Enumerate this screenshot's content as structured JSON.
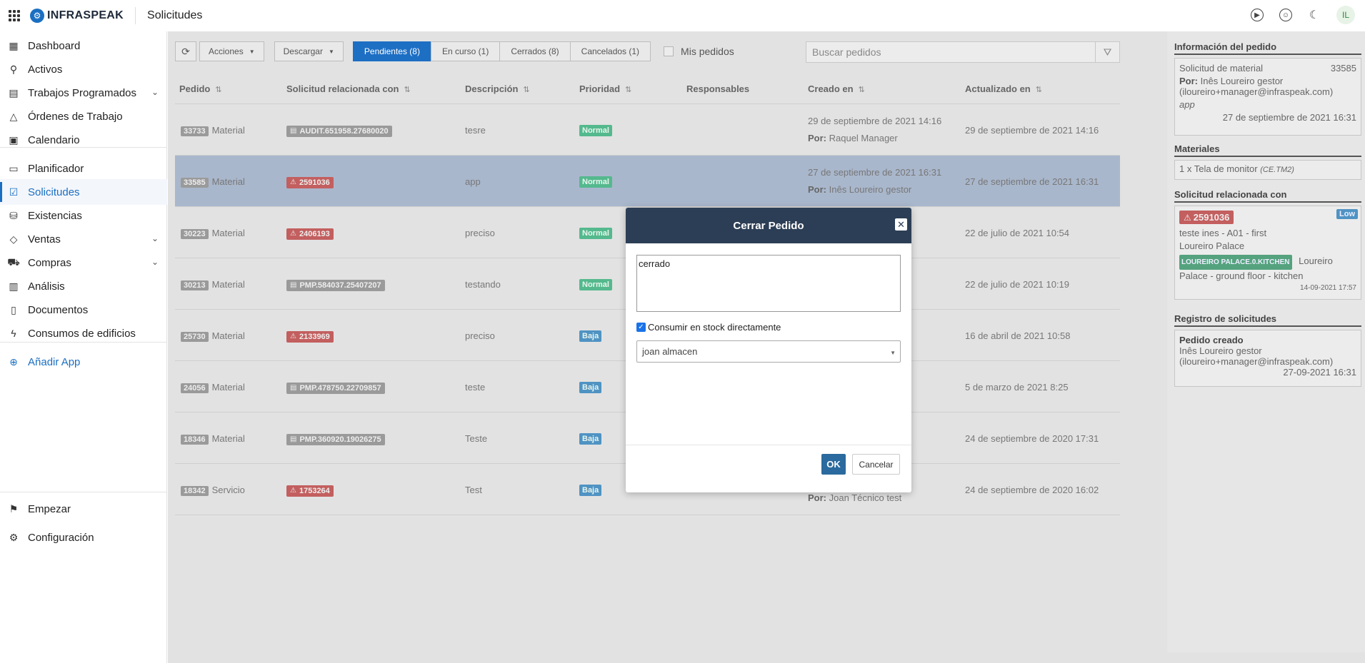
{
  "header": {
    "brand": "INFRASPEAK",
    "brand_mark": "⚙",
    "title": "Solicitudes",
    "avatar_initials": "IL"
  },
  "sidebar": {
    "items": [
      {
        "label": "Dashboard",
        "icon": "dashboard-icon",
        "glyph": "▦"
      },
      {
        "label": "Activos",
        "icon": "pin-icon",
        "glyph": "⚲"
      },
      {
        "label": "Trabajos Programados",
        "icon": "calendar-gear-icon",
        "glyph": "▤",
        "has_chevron": true
      },
      {
        "label": "Órdenes de Trabajo",
        "icon": "warning-icon",
        "glyph": "△"
      },
      {
        "label": "Calendario",
        "icon": "calendar-icon",
        "glyph": "▣"
      },
      {
        "label": "Planificador",
        "icon": "planner-icon",
        "glyph": "▭"
      },
      {
        "label": "Solicitudes",
        "icon": "requests-icon",
        "glyph": "☑",
        "active": true
      },
      {
        "label": "Existencias",
        "icon": "stock-icon",
        "glyph": "⛁"
      },
      {
        "label": "Ventas",
        "icon": "tag-icon",
        "glyph": "◇",
        "has_chevron": true
      },
      {
        "label": "Compras",
        "icon": "cart-icon",
        "glyph": "⛟",
        "has_chevron": true
      },
      {
        "label": "Análisis",
        "icon": "bar-chart-icon",
        "glyph": "▥"
      },
      {
        "label": "Documentos",
        "icon": "document-icon",
        "glyph": "▯"
      },
      {
        "label": "Consumos de edificios",
        "icon": "lightning-icon",
        "glyph": "ϟ"
      },
      {
        "label": "Añadir App",
        "icon": "plus-circle-icon",
        "glyph": "⊕"
      }
    ],
    "footer": [
      {
        "label": "Empezar",
        "icon": "flag-icon",
        "glyph": "⚑"
      },
      {
        "label": "Configuración",
        "icon": "gear-icon",
        "glyph": "⚙"
      }
    ]
  },
  "toolbar": {
    "acciones": "Acciones",
    "descargar": "Descargar",
    "tabs": [
      "Pendientes (8)",
      "En curso (1)",
      "Cerrados (8)",
      "Cancelados (1)"
    ],
    "mis_pedidos": "Mis pedidos",
    "search_placeholder": "Buscar pedidos"
  },
  "table": {
    "headers": [
      "Pedido",
      "Solicitud relacionada con",
      "Descripción",
      "Prioridad",
      "Responsables",
      "Creado en",
      "Actualizado en"
    ],
    "rows": [
      {
        "id": "33733",
        "type": "Material",
        "ref": "AUDIT.651958.27680020",
        "ref_color": "grey",
        "ref_icon": "clipboard-icon",
        "desc": "tesre",
        "priority": "Normal",
        "created": "29 de septiembre de 2021 14:16",
        "by_label": "Por:",
        "by": "Raquel Manager",
        "updated": "29 de septiembre de 2021 14:16"
      },
      {
        "id": "33585",
        "type": "Material",
        "ref": "2591036",
        "ref_color": "red",
        "ref_icon": "warning-icon",
        "desc": "app",
        "priority": "Normal",
        "created": "27 de septiembre de 2021 16:31",
        "by_label": "Por:",
        "by": "Inês Loureiro gestor",
        "updated": "27 de septiembre de 2021 16:31",
        "selected": true
      },
      {
        "id": "30223",
        "type": "Material",
        "ref": "2406193",
        "ref_color": "red",
        "ref_icon": "warning-icon",
        "desc": "preciso",
        "priority": "Normal",
        "created": "",
        "by_label": "",
        "by": "",
        "updated": "22 de julio de 2021 10:54"
      },
      {
        "id": "30213",
        "type": "Material",
        "ref": "PMP.584037.25407207",
        "ref_color": "grey",
        "ref_icon": "calendar-icon",
        "desc": "testando",
        "priority": "Normal",
        "created": "",
        "by_label": "",
        "by": "",
        "updated": "22 de julio de 2021 10:19"
      },
      {
        "id": "25730",
        "type": "Material",
        "ref": "2133969",
        "ref_color": "red",
        "ref_icon": "warning-icon",
        "desc": "preciso",
        "priority": "Baja",
        "created": "",
        "by_label": "",
        "by": "",
        "updated": "16 de abril de 2021 10:58"
      },
      {
        "id": "24056",
        "type": "Material",
        "ref": "PMP.478750.22709857",
        "ref_color": "grey",
        "ref_icon": "calendar-icon",
        "desc": "teste",
        "priority": "Baja",
        "created": "",
        "by_label": "",
        "by": "",
        "updated": "5 de marzo de 2021 8:25"
      },
      {
        "id": "18346",
        "type": "Material",
        "ref": "PMP.360920.19026275",
        "ref_color": "grey",
        "ref_icon": "calendar-icon",
        "desc": "Teste",
        "priority": "Baja",
        "created": "",
        "by_label": "",
        "by": "",
        "updated": "24 de septiembre de 2020 17:31"
      },
      {
        "id": "18342",
        "type": "Servicio",
        "ref": "1753264",
        "ref_color": "red",
        "ref_icon": "warning-icon",
        "desc": "Test",
        "priority": "Baja",
        "created": "",
        "by_label": "Por:",
        "by": "Joan Técnico test",
        "updated": "24 de septiembre de 2020 16:02"
      }
    ]
  },
  "right_panel": {
    "info_title": "Información del pedido",
    "info_type": "Solicitud de material",
    "info_id": "33585",
    "info_by_label": "Por:",
    "info_by": "Inês Loureiro gestor",
    "info_email": "(iloureiro+manager@infraspeak.com)",
    "info_desc": "app",
    "info_date": "27 de septiembre de 2021 16:31",
    "materials_title": "Materiales",
    "material": "1 x Tela de monitor",
    "material_code": "(CE.TM2)",
    "related_title": "Solicitud relacionada con",
    "related_ref": "2591036",
    "related_priority": "Low",
    "related_desc": "teste ines - A01 - first",
    "related_place": "Loureiro Palace",
    "related_loc_badge": "LOUREIRO PALACE.0.KITCHEN",
    "related_loc_text": "Loureiro Palace - ground floor - kitchen",
    "related_date": "14-09-2021 17:57",
    "log_title": "Registro de solicitudes",
    "log_event": "Pedido creado",
    "log_by": "Inês Loureiro gestor",
    "log_email": "(iloureiro+manager@infraspeak.com)",
    "log_date": "27-09-2021 16:31"
  },
  "modal": {
    "title": "Cerrar Pedido",
    "textarea_value": "cerrado",
    "checkbox_label": "Consumir en stock directamente",
    "checkbox_checked": true,
    "select_value": "joan almacen",
    "ok": "OK",
    "cancel": "Cancelar"
  },
  "colors": {
    "accent": "#1d6fc4",
    "modal_header": "#2c3e55",
    "priority_normal": "#54b98d",
    "priority_baja": "#4f93c3",
    "ref_red": "#c35f5f"
  }
}
